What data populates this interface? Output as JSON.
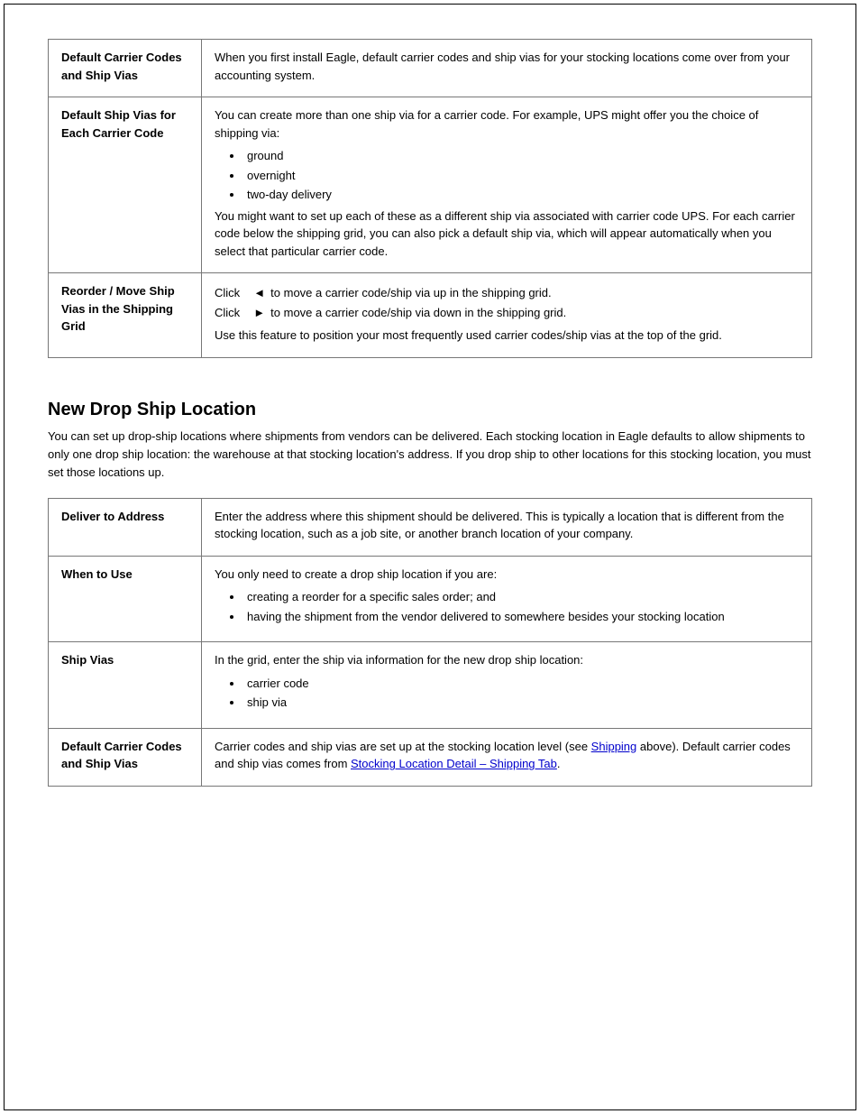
{
  "table1": {
    "rows": [
      {
        "left": "Default Carrier Codes and Ship Vias",
        "right": "When you first install Eagle, default carrier codes and ship vias for your stocking locations come over from your accounting system."
      },
      {
        "left": "Default Ship Vias for Each Carrier Code",
        "right_p1": "You can create more than one ship via for a carrier code. For example, UPS might offer you the choice of shipping via:",
        "bullets": [
          "ground",
          "overnight",
          "two-day delivery"
        ],
        "right_p2": "You might want to set up each of these as a different ship via associated with carrier code UPS. For each carrier code below the shipping grid, you can also pick a default ship via, which will appear automatically when you select that particular carrier code."
      },
      {
        "left": "Reorder / Move Ship Vias in the Shipping Grid",
        "arrow1": "Click    to move a carrier code/ship via up in the shipping grid.",
        "arrow2": "Click    to move a carrier code/ship via down in the shipping grid.",
        "right_p3": "Use this feature to position your most frequently used carrier codes/ship vias at the top of the grid."
      }
    ]
  },
  "section2": {
    "title": "New Drop Ship Location",
    "intro": "You can set up drop-ship locations where shipments from vendors can be delivered. Each stocking location in Eagle defaults to allow shipments to only one drop ship location: the warehouse at that stocking location's address. If you drop ship to other locations for this stocking location, you must set those locations up."
  },
  "table2": {
    "rows": [
      {
        "left": "Deliver to Address",
        "right": "Enter the address where this shipment should be delivered. This is typically a location that is different from the stocking location, such as a job site, or another branch location of your company."
      },
      {
        "left": "When to Use",
        "right_p1": "You only need to create a drop ship location if you are:",
        "bullets": [
          "creating a reorder for a specific sales order; and",
          "having the shipment from the vendor delivered to somewhere besides your stocking location"
        ]
      },
      {
        "left": "Ship Vias",
        "right_p1": "In the grid, enter the ship via information for the new drop ship location:",
        "bullets": [
          "carrier code",
          "ship via"
        ]
      },
      {
        "left": "Default Carrier Codes and Ship Vias",
        "right_pre": "Carrier codes and ship vias are set up at the stocking location level (see ",
        "link1": "Shipping",
        "right_mid": " above). Default carrier codes and ship vias comes from ",
        "link2": "Stocking Location Detail – Shipping Tab",
        "right_post": "."
      }
    ]
  }
}
